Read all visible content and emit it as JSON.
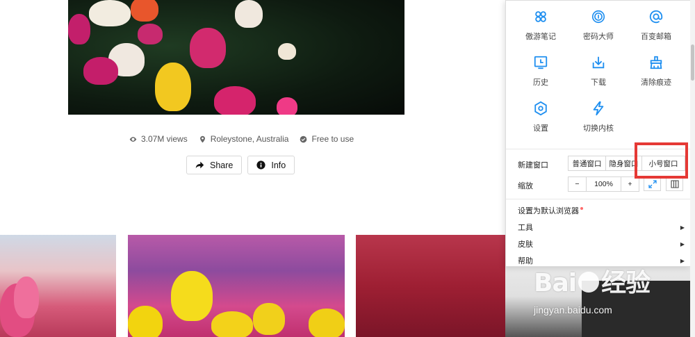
{
  "photo": {
    "views": "3.07M views",
    "location": "Roleystone, Australia",
    "license": "Free to use",
    "share_label": "Share",
    "info_label": "Info"
  },
  "menu": {
    "grid": [
      {
        "label": "傲游笔记",
        "icon": "note-icon"
      },
      {
        "label": "密码大师",
        "icon": "fingerprint-icon"
      },
      {
        "label": "百变邮箱",
        "icon": "email-at-icon"
      },
      {
        "label": "历史",
        "icon": "history-icon"
      },
      {
        "label": "下载",
        "icon": "download-icon"
      },
      {
        "label": "清除痕迹",
        "icon": "clear-traces-icon"
      },
      {
        "label": "设置",
        "icon": "gear-icon"
      },
      {
        "label": "切换内核",
        "icon": "lightning-icon"
      }
    ],
    "new_window_label": "新建窗口",
    "new_window_options": [
      "普通窗口",
      "隐身窗口",
      "小号窗口"
    ],
    "zoom_label": "缩放",
    "zoom_minus": "−",
    "zoom_value": "100%",
    "zoom_plus": "+",
    "set_default": "设置为默认浏览器",
    "tools": "工具",
    "skins": "皮肤",
    "help": "帮助"
  },
  "watermark": {
    "brand": "Bai",
    "brand_tail": "经验",
    "url": "jingyan.baidu.com"
  },
  "colors": {
    "accent": "#1f8ff0",
    "highlight": "#e53935"
  }
}
